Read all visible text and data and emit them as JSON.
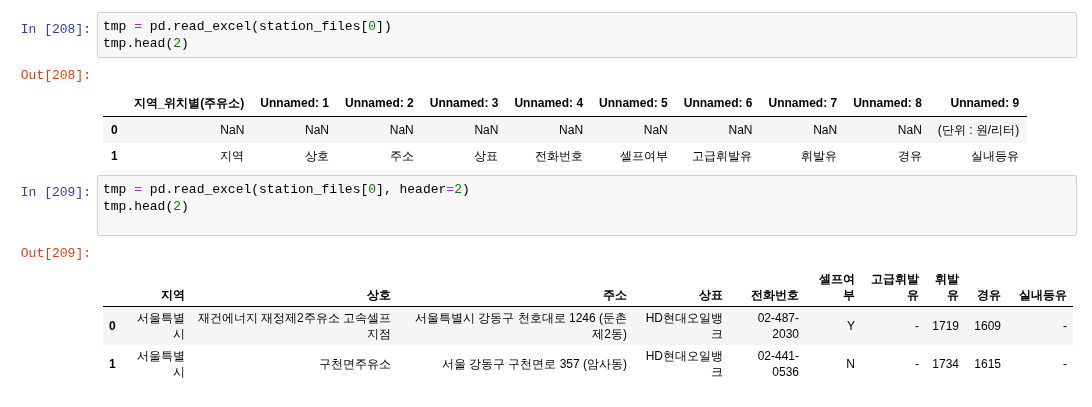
{
  "cells": [
    {
      "input_prompt": "In [208]:",
      "code": [
        [
          {
            "kind": "plain",
            "text": "tmp "
          },
          {
            "kind": "operator",
            "text": "="
          },
          {
            "kind": "plain",
            "text": " pd.read_excel(station_files["
          },
          {
            "kind": "number",
            "text": "0"
          },
          {
            "kind": "plain",
            "text": "])"
          }
        ],
        [
          {
            "kind": "plain",
            "text": "tmp.head("
          },
          {
            "kind": "number",
            "text": "2"
          },
          {
            "kind": "plain",
            "text": ")"
          }
        ]
      ],
      "output_prompt": "Out[208]:",
      "table": {
        "columns": [
          "지역_위치별(주유소)",
          "Unnamed: 1",
          "Unnamed: 2",
          "Unnamed: 3",
          "Unnamed: 4",
          "Unnamed: 5",
          "Unnamed: 6",
          "Unnamed: 7",
          "Unnamed: 8",
          "Unnamed: 9"
        ],
        "rows": [
          {
            "index": "0",
            "values": [
              "NaN",
              "NaN",
              "NaN",
              "NaN",
              "NaN",
              "NaN",
              "NaN",
              "NaN",
              "NaN",
              "(단위 : 원/리터)"
            ]
          },
          {
            "index": "1",
            "values": [
              "지역",
              "상호",
              "주소",
              "상표",
              "전화번호",
              "셀프여부",
              "고급휘발유",
              "휘발유",
              "경유",
              "실내등유"
            ]
          }
        ]
      }
    },
    {
      "input_prompt": "In [209]:",
      "code": [
        [
          {
            "kind": "plain",
            "text": "tmp "
          },
          {
            "kind": "operator",
            "text": "="
          },
          {
            "kind": "plain",
            "text": " pd.read_excel(station_files["
          },
          {
            "kind": "number",
            "text": "0"
          },
          {
            "kind": "plain",
            "text": "], header"
          },
          {
            "kind": "operator",
            "text": "="
          },
          {
            "kind": "number",
            "text": "2"
          },
          {
            "kind": "plain",
            "text": ")"
          }
        ],
        [
          {
            "kind": "plain",
            "text": "tmp.head("
          },
          {
            "kind": "number",
            "text": "2"
          },
          {
            "kind": "plain",
            "text": ")"
          }
        ]
      ],
      "output_prompt": "Out[209]:",
      "table": {
        "columns": [
          "지역",
          "상호",
          "주소",
          "상표",
          "전화번호",
          "셀프여부",
          "고급휘발유",
          "휘발유",
          "경유",
          "실내등유"
        ],
        "rows": [
          {
            "index": "0",
            "values": [
              "서울특별시",
              "재건에너지 재정제2주유소 고속셀프지점",
              "서울특별시 강동구 천호대로 1246 (둔촌제2동)",
              "HD현대오일뱅크",
              "02-487-2030",
              "Y",
              "-",
              "1719",
              "1609",
              "-"
            ]
          },
          {
            "index": "1",
            "values": [
              "서울특별시",
              "구천면주유소",
              "서울 강동구 구천면로 357 (암사동)",
              "HD현대오일뱅크",
              "02-441-0536",
              "N",
              "-",
              "1734",
              "1615",
              "-"
            ]
          }
        ]
      }
    }
  ]
}
